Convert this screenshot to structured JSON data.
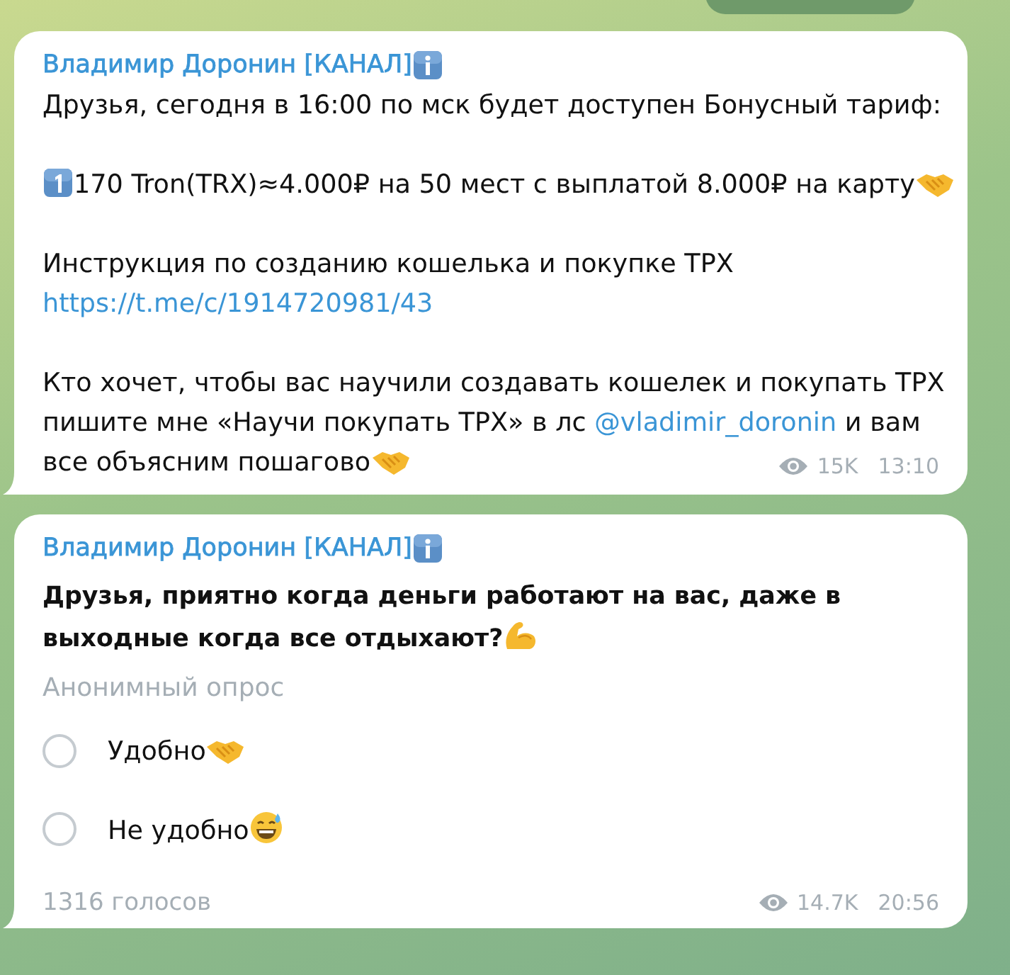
{
  "messages": [
    {
      "kind": "post",
      "author": "Владимир Доронин [КАНАЛ]",
      "badge": {
        "kind": "info"
      },
      "paragraphs": [
        [
          [
            {
              "kind": "text",
              "text": "Друзья, сегодня в 16:00 по мск будет доступен Бонусный тариф:"
            }
          ]
        ],
        [
          [
            {
              "kind": "keycap"
            },
            {
              "kind": "text",
              "text": "170 Tron(TRX)≈4.000₽ на 50 мест с выплатой 8.000₽ на карту"
            },
            {
              "kind": "handshake"
            }
          ]
        ],
        [
          [
            {
              "kind": "text",
              "text": "Инструкция по созданию кошелька и покупке ТРХ"
            }
          ],
          [
            {
              "kind": "link",
              "text": "https://t.me/c/1914720981/43"
            }
          ]
        ],
        [
          [
            {
              "kind": "text",
              "text": "Кто хочет, чтобы вас научили создавать кошелек и покупать ТРХ"
            }
          ],
          [
            {
              "kind": "text",
              "text": "пишите мне «Научи покупать ТРХ» в лс "
            },
            {
              "kind": "mention",
              "text": "@vladimir_doronin"
            },
            {
              "kind": "text",
              "text": " и вам"
            }
          ],
          [
            {
              "kind": "text",
              "text": "все объясним пошагово"
            },
            {
              "kind": "handshake"
            }
          ]
        ]
      ],
      "views": "15K",
      "time": "13:10"
    },
    {
      "kind": "poll",
      "author": "Владимир Доронин [КАНАЛ]",
      "badge": {
        "kind": "info"
      },
      "question": [
        [
          {
            "kind": "text",
            "text": "Друзья, приятно когда деньги работают на вас, даже в"
          }
        ],
        [
          {
            "kind": "text",
            "text": "выходные когда все отдыхают?"
          },
          {
            "kind": "muscle"
          }
        ]
      ],
      "poll_type": "Анонимный опрос",
      "options": [
        {
          "parts": [
            {
              "kind": "text",
              "text": "Удобно"
            },
            {
              "kind": "handshake"
            }
          ],
          "selected": false
        },
        {
          "parts": [
            {
              "kind": "text",
              "text": "Не удобно"
            },
            {
              "kind": "sweat-smile"
            }
          ],
          "selected": false
        }
      ],
      "votes": "1316 голосов",
      "views": "14.7K",
      "time": "20:56"
    }
  ]
}
